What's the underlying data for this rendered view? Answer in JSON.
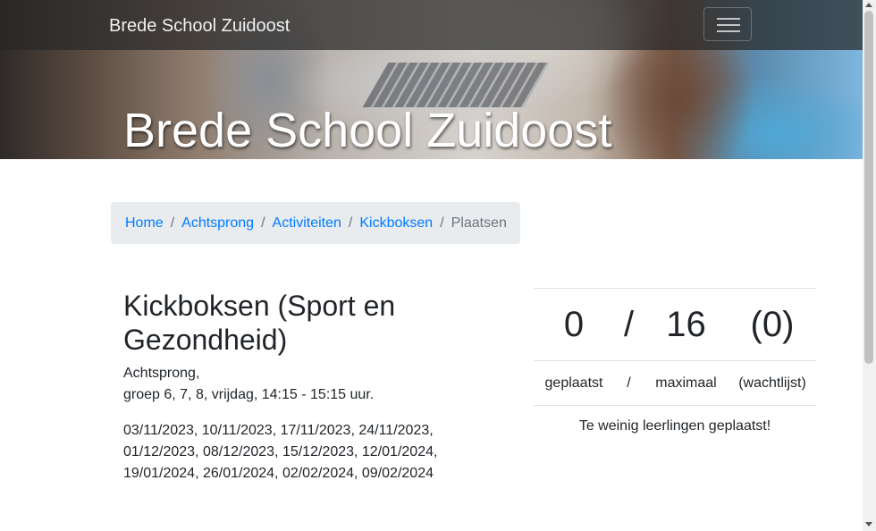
{
  "navbar": {
    "brand": "Brede School Zuidoost",
    "menu_icon": "hamburger-menu-icon"
  },
  "hero": {
    "title": "Brede School Zuidoost"
  },
  "breadcrumb": {
    "items": [
      "Home",
      "Achtsprong",
      "Activiteiten",
      "Kickboksen"
    ],
    "current": "Plaatsen",
    "separator": "/"
  },
  "activity": {
    "title": "Kickboksen (Sport en Gezondheid)",
    "location": "Achtsprong,",
    "schedule": "groep 6, 7, 8, vrijdag, 14:15 - 15:15 uur.",
    "dates": "03/11/2023, 10/11/2023, 17/11/2023, 24/11/2023, 01/12/2023, 08/12/2023, 15/12/2023, 12/01/2024, 19/01/2024, 26/01/2024, 02/02/2024, 09/02/2024"
  },
  "stats": {
    "placed": "0",
    "separator": "/",
    "maximum": "16",
    "waitlist": "(0)",
    "placed_label": "geplaatst",
    "maximum_label": "maximaal",
    "waitlist_label": "(wachtlijst)",
    "warning": "Te weinig leerlingen geplaatst!"
  },
  "colors": {
    "link": "#007bff",
    "breadcrumb_bg": "#e9ecef",
    "navbar_bg": "rgba(40,40,40,.72)"
  }
}
